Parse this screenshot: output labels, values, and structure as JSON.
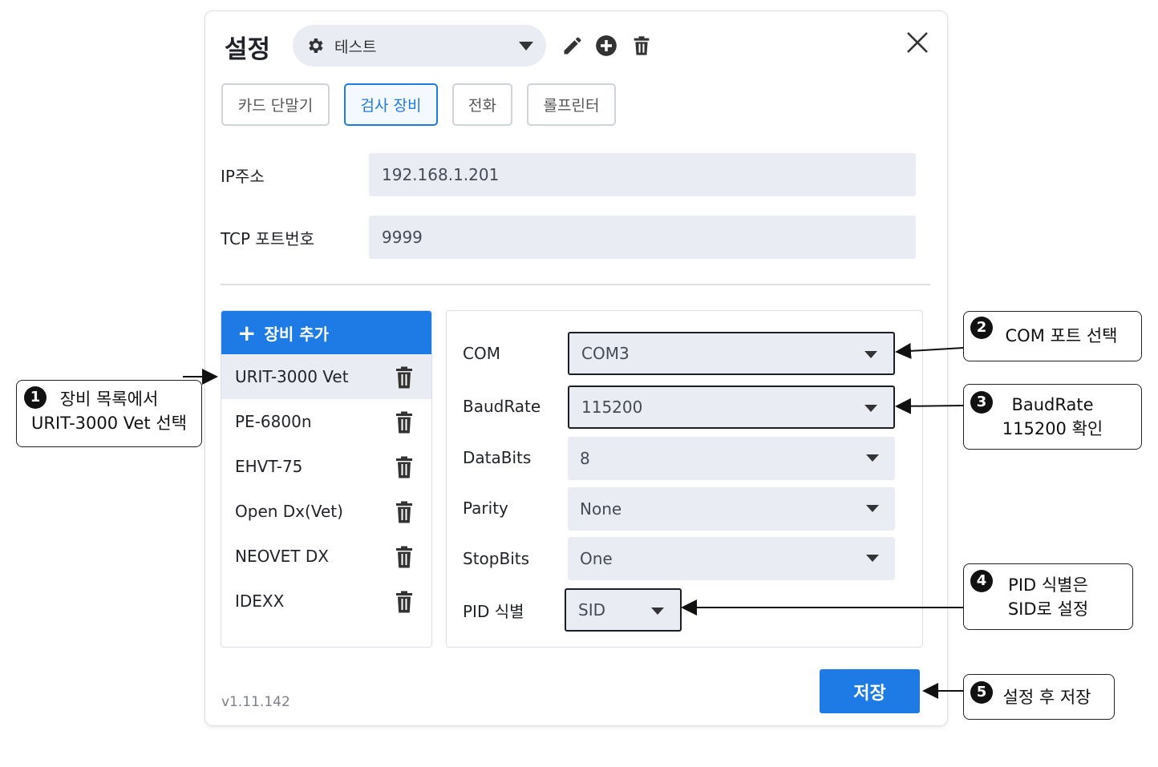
{
  "dialog": {
    "title": "설정",
    "profile_name": "테스트",
    "tabs": [
      {
        "label": "카드 단말기",
        "active": false
      },
      {
        "label": "검사 장비",
        "active": true
      },
      {
        "label": "전화",
        "active": false
      },
      {
        "label": "롤프린터",
        "active": false
      }
    ],
    "fields": {
      "ip_label": "IP주소",
      "ip_value": "192.168.1.201",
      "port_label": "TCP 포트번호",
      "port_value": "9999"
    },
    "add_device_label": "장비 추가",
    "devices": [
      "URIT-3000 Vet",
      "PE-6800n",
      "EHVT-75",
      "Open Dx(Vet)",
      "NEOVET DX",
      "IDEXX"
    ],
    "selected_device": "URIT-3000 Vet",
    "serial": {
      "com_label": "COM",
      "com_value": "COM3",
      "baud_label": "BaudRate",
      "baud_value": "115200",
      "databits_label": "DataBits",
      "databits_value": "8",
      "parity_label": "Parity",
      "parity_value": "None",
      "stopbits_label": "StopBits",
      "stopbits_value": "One",
      "pid_label": "PID 식별",
      "pid_value": "SID"
    },
    "version": "v1.11.142",
    "save_label": "저장"
  },
  "callouts": {
    "c1": {
      "num": "1",
      "line1": "장비 목록에서",
      "line2": "URIT-3000 Vet 선택"
    },
    "c2": {
      "num": "2",
      "line1": "COM 포트 선택"
    },
    "c3": {
      "num": "3",
      "line1": "BaudRate",
      "line2": "115200 확인"
    },
    "c4": {
      "num": "4",
      "line1": "PID 식별은",
      "line2": "SID로 설정"
    },
    "c5": {
      "num": "5",
      "line1": "설정 후 저장"
    }
  },
  "colors": {
    "accent": "#1e7be6",
    "input_bg": "#e9ecf3",
    "border": "#dcdfe4"
  }
}
